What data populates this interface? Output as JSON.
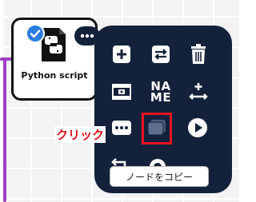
{
  "node": {
    "label": "Python script",
    "icon": "python-file-icon",
    "selected": true
  },
  "menu": {
    "icons": [
      "add-icon",
      "swap-icon",
      "trash-icon",
      "database-icon",
      "rename-icon",
      "split-icon",
      "more-icon",
      "copy-node-icon",
      "play-icon",
      "undo-icon",
      "info-icon"
    ],
    "rename_top": "NA",
    "rename_bottom": "ME"
  },
  "annotation": {
    "click_label": "クリック",
    "tooltip": "ノードをコピー"
  },
  "colors": {
    "panel": "#14213b",
    "wire": "#a13fc0",
    "highlight": "#e8141e",
    "check": "#2b7de0"
  }
}
